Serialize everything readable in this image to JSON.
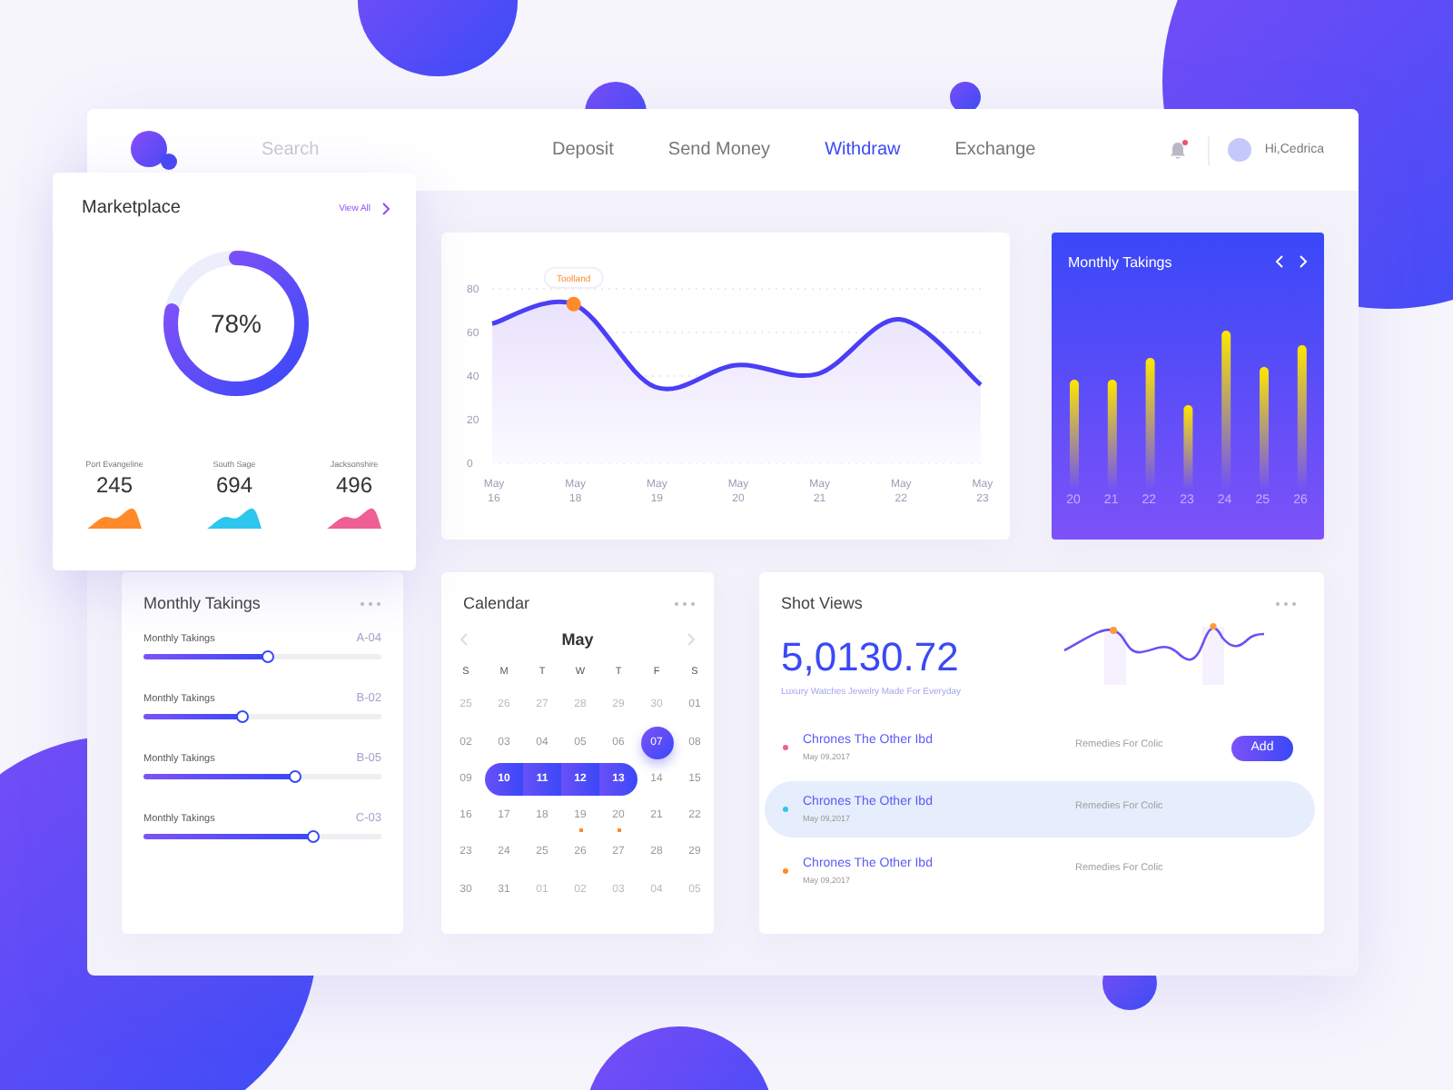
{
  "header": {
    "search": {
      "placeholder": "Search"
    },
    "nav": [
      {
        "label": "Deposit",
        "selected": false
      },
      {
        "label": "Send Money",
        "selected": false
      },
      {
        "label": "Withdraw",
        "selected": true
      },
      {
        "label": "Exchange",
        "selected": false
      }
    ],
    "notifications": {
      "unread": true
    },
    "user": {
      "greeting": "Hi,Cedrica"
    }
  },
  "marketplace": {
    "title": "Marketplace",
    "link": "View All",
    "reading": "78%",
    "stats": [
      {
        "name": "Port Evangeline",
        "value": "245",
        "color": "#ff8a2b"
      },
      {
        "name": "South Sage",
        "value": "694",
        "color": "#2ec5ef"
      },
      {
        "name": "Jacksonshire",
        "value": "496",
        "color": "#ee5f93"
      }
    ]
  },
  "line_chart": {
    "chart_data": {
      "type": "area",
      "categories": [
        "May 16",
        "May 18",
        "May 19",
        "May 20",
        "May 21",
        "May 22",
        "May 23"
      ],
      "series": [
        {
          "color": "#4a3ff5",
          "values": [
            64,
            73,
            35,
            45,
            41,
            66,
            36
          ]
        }
      ],
      "yticks": [
        0,
        20,
        40,
        60,
        80
      ],
      "ylim": [
        0,
        80
      ],
      "annotations": [
        {
          "text": "Toolland",
          "x": "May 18",
          "y": 73
        }
      ]
    }
  },
  "bar_panel": {
    "title": "Monthly Takings",
    "days": [
      "20",
      "21",
      "22",
      "23",
      "24",
      "25",
      "26"
    ]
  },
  "takings": {
    "title": "Monthly Takings",
    "rows": [
      {
        "label": "Monthly Takings",
        "code": "A-04",
        "level": 0.53
      },
      {
        "label": "Monthly Takings",
        "code": "B-02",
        "level": 0.42
      },
      {
        "label": "Monthly Takings",
        "code": "B-05",
        "level": 0.64
      },
      {
        "label": "Monthly Takings",
        "code": "C-03",
        "level": 0.72
      }
    ]
  },
  "calendar": {
    "title": "Calendar",
    "month": "May",
    "weekdays": [
      "S",
      "M",
      "T",
      "W",
      "T",
      "F",
      "S"
    ],
    "days": [
      {
        "label": "25",
        "muted": true,
        "selected": false,
        "in_range": false,
        "event": false
      },
      {
        "label": "26",
        "muted": true,
        "selected": false,
        "in_range": false,
        "event": false
      },
      {
        "label": "27",
        "muted": true,
        "selected": false,
        "in_range": false,
        "event": false
      },
      {
        "label": "28",
        "muted": true,
        "selected": false,
        "in_range": false,
        "event": false
      },
      {
        "label": "29",
        "muted": true,
        "selected": false,
        "in_range": false,
        "event": false
      },
      {
        "label": "30",
        "muted": true,
        "selected": false,
        "in_range": false,
        "event": false
      },
      {
        "label": "01",
        "muted": false,
        "selected": false,
        "in_range": false,
        "event": false
      },
      {
        "label": "02",
        "muted": false,
        "selected": false,
        "in_range": false,
        "event": false
      },
      {
        "label": "03",
        "muted": false,
        "selected": false,
        "in_range": false,
        "event": false
      },
      {
        "label": "04",
        "muted": false,
        "selected": false,
        "in_range": false,
        "event": false
      },
      {
        "label": "05",
        "muted": false,
        "selected": false,
        "in_range": false,
        "event": false
      },
      {
        "label": "06",
        "muted": false,
        "selected": false,
        "in_range": false,
        "event": false
      },
      {
        "label": "07",
        "muted": false,
        "selected": true,
        "in_range": false,
        "event": false
      },
      {
        "label": "08",
        "muted": false,
        "selected": false,
        "in_range": false,
        "event": false
      },
      {
        "label": "09",
        "muted": false,
        "selected": false,
        "in_range": false,
        "event": false
      },
      {
        "label": "10",
        "muted": false,
        "selected": false,
        "in_range": true,
        "event": false
      },
      {
        "label": "11",
        "muted": false,
        "selected": false,
        "in_range": true,
        "event": false
      },
      {
        "label": "12",
        "muted": false,
        "selected": false,
        "in_range": true,
        "event": false
      },
      {
        "label": "13",
        "muted": false,
        "selected": false,
        "in_range": true,
        "event": false
      },
      {
        "label": "14",
        "muted": false,
        "selected": false,
        "in_range": false,
        "event": false
      },
      {
        "label": "15",
        "muted": false,
        "selected": false,
        "in_range": false,
        "event": false
      },
      {
        "label": "16",
        "muted": false,
        "selected": false,
        "in_range": false,
        "event": false
      },
      {
        "label": "17",
        "muted": false,
        "selected": false,
        "in_range": false,
        "event": false
      },
      {
        "label": "18",
        "muted": false,
        "selected": false,
        "in_range": false,
        "event": false
      },
      {
        "label": "19",
        "muted": false,
        "selected": false,
        "in_range": false,
        "event": true
      },
      {
        "label": "20",
        "muted": false,
        "selected": false,
        "in_range": false,
        "event": true
      },
      {
        "label": "21",
        "muted": false,
        "selected": false,
        "in_range": false,
        "event": false
      },
      {
        "label": "22",
        "muted": false,
        "selected": false,
        "in_range": false,
        "event": false
      },
      {
        "label": "23",
        "muted": false,
        "selected": false,
        "in_range": false,
        "event": false
      },
      {
        "label": "24",
        "muted": false,
        "selected": false,
        "in_range": false,
        "event": false
      },
      {
        "label": "25",
        "muted": false,
        "selected": false,
        "in_range": false,
        "event": false
      },
      {
        "label": "26",
        "muted": false,
        "selected": false,
        "in_range": false,
        "event": false
      },
      {
        "label": "27",
        "muted": false,
        "selected": false,
        "in_range": false,
        "event": false
      },
      {
        "label": "28",
        "muted": false,
        "selected": false,
        "in_range": false,
        "event": false
      },
      {
        "label": "29",
        "muted": false,
        "selected": false,
        "in_range": false,
        "event": false
      },
      {
        "label": "30",
        "muted": false,
        "selected": false,
        "in_range": false,
        "event": false
      },
      {
        "label": "31",
        "muted": false,
        "selected": false,
        "in_range": false,
        "event": false
      },
      {
        "label": "01",
        "muted": true,
        "selected": false,
        "in_range": false,
        "event": false
      },
      {
        "label": "02",
        "muted": true,
        "selected": false,
        "in_range": false,
        "event": false
      },
      {
        "label": "03",
        "muted": true,
        "selected": false,
        "in_range": false,
        "event": false
      },
      {
        "label": "04",
        "muted": true,
        "selected": false,
        "in_range": false,
        "event": false
      },
      {
        "label": "05",
        "muted": true,
        "selected": false,
        "in_range": false,
        "event": false
      }
    ]
  },
  "shot_views": {
    "title": "Shot Views",
    "total": "5,0130.72",
    "caption": "Luxury Watches Jewelry Made For Everyday",
    "items": [
      {
        "title": "Chrones The Other Ibd",
        "date": "May 09,2017",
        "note": "Remedies For Colic",
        "color": "#ee5f93",
        "selected": false,
        "action": "Add"
      },
      {
        "title": "Chrones The Other Ibd",
        "date": "May 09,2017",
        "note": "Remedies For Colic",
        "color": "#2ec5ef",
        "selected": true
      },
      {
        "title": "Chrones The Other Ibd",
        "date": "May 09,2017",
        "note": "Remedies For Colic",
        "color": "#ff8a2b",
        "selected": false
      }
    ]
  }
}
